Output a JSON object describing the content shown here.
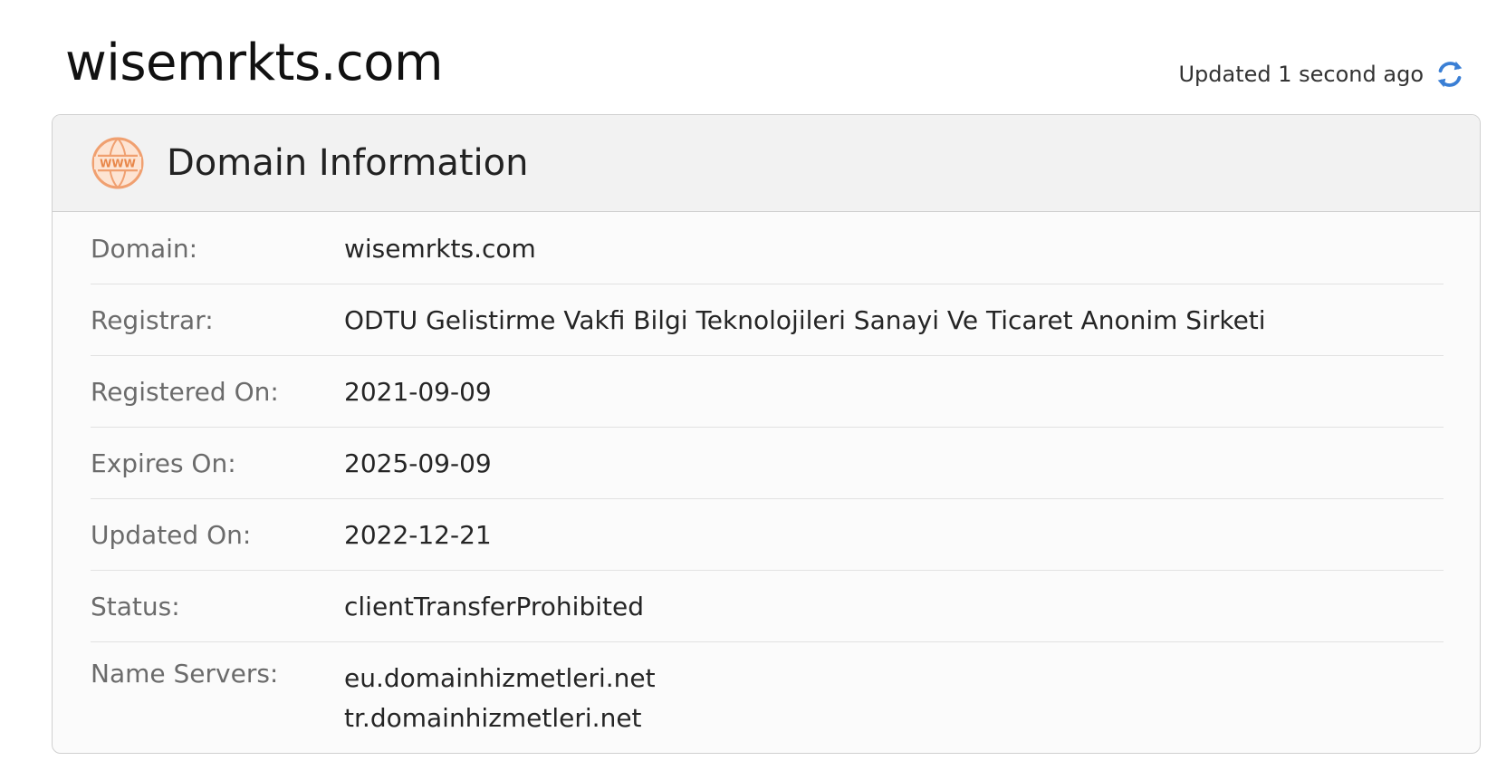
{
  "header": {
    "title": "wisemrkts.com",
    "updated_text": "Updated 1 second ago",
    "refresh_icon": "refresh-icon"
  },
  "card": {
    "title": "Domain Information",
    "icon": "www-icon",
    "icon_text": "WWW",
    "rows": [
      {
        "label": "Domain:",
        "value": "wisemrkts.com"
      },
      {
        "label": "Registrar:",
        "value": "ODTU Gelistirme Vakfi Bilgi Teknolojileri Sanayi Ve Ticaret Anonim Sirketi"
      },
      {
        "label": "Registered On:",
        "value": "2021-09-09"
      },
      {
        "label": "Expires On:",
        "value": "2025-09-09"
      },
      {
        "label": "Updated On:",
        "value": "2022-12-21"
      },
      {
        "label": "Status:",
        "value": "clientTransferProhibited"
      }
    ],
    "name_servers": {
      "label": "Name Servers:",
      "values": [
        "eu.domainhizmetleri.net",
        "tr.domainhizmetleri.net"
      ]
    }
  },
  "colors": {
    "accent_orange": "#f0a070",
    "refresh_blue": "#3a7fd5",
    "label_gray": "#6b6b6b",
    "border": "#d0d0d0"
  }
}
